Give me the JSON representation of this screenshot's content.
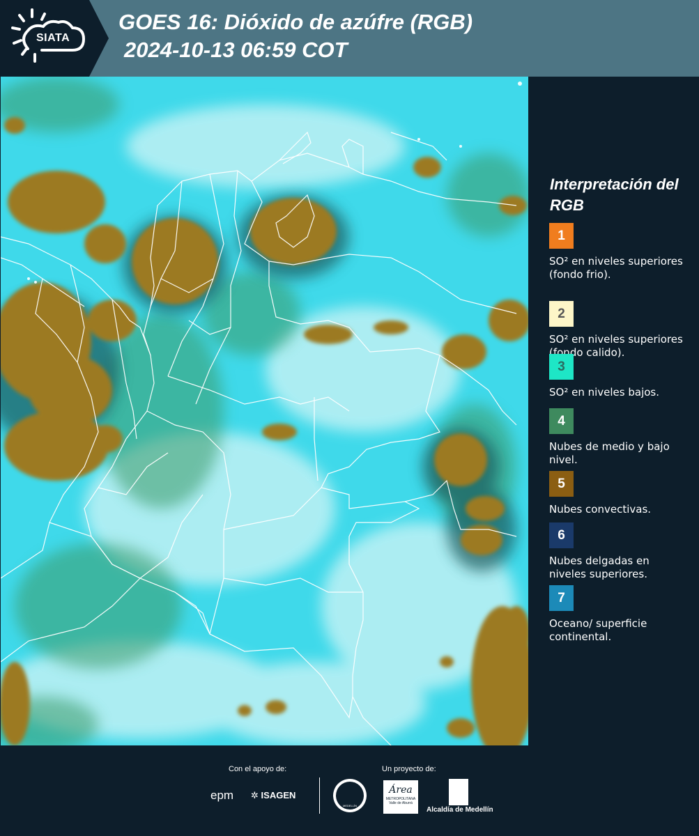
{
  "header": {
    "logo_text": "SIATA",
    "title_line1": "GOES 16: Dióxido de azúfre (RGB)",
    "title_line2": "2024-10-13 06:59 COT"
  },
  "map": {
    "icon": "satellite-map",
    "colors": {
      "background": "#3fd9ea",
      "convective": "#9c7a22",
      "low_cloud": "#3b9a68",
      "border": "#ffffff"
    }
  },
  "legend": {
    "title": "Interpretación del RGB",
    "items": [
      {
        "number": "1",
        "color": "#f07d1e",
        "text_color": "#ffffff",
        "label": "SO² en niveles superiores (fondo frio)."
      },
      {
        "number": "2",
        "color": "#fdf6c8",
        "text_color": "#555555",
        "label": "SO² en niveles superiores (fondo calido)."
      },
      {
        "number": "3",
        "color": "#1ee6c6",
        "text_color": "#2a6b60",
        "label": "SO² en niveles bajos."
      },
      {
        "number": "4",
        "color": "#3e8a5e",
        "text_color": "#ffffff",
        "label": "Nubes de medio y bajo nivel."
      },
      {
        "number": "5",
        "color": "#8b5e12",
        "text_color": "#ffffff",
        "label": "Nubes convectivas."
      },
      {
        "number": "6",
        "color": "#1a3a6a",
        "text_color": "#ffffff",
        "label": "Nubes delgadas en niveles superiores."
      },
      {
        "number": "7",
        "color": "#1c8ab8",
        "text_color": "#ffffff",
        "label": "Oceano/ superficie continental."
      }
    ]
  },
  "footer": {
    "support_label": "Con el apoyo de:",
    "project_label": "Un proyecto de:",
    "logos": {
      "epm": "epm",
      "isagen": "ISAGEN",
      "medellin_seal": "MEDELLÍN",
      "area_metro": "Área",
      "area_metro_sub": "METROPOLITANA",
      "area_metro_sub2": "Valle de Aburrá",
      "alcaldia": "Alcaldía de Medellín"
    }
  }
}
